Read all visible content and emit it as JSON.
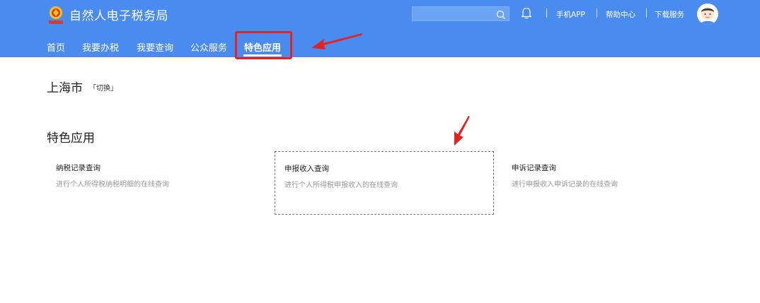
{
  "header": {
    "title": "自然人电子税务局",
    "search_placeholder": "",
    "links": [
      "手机APP",
      "帮助中心",
      "下载服务"
    ]
  },
  "nav": {
    "items": [
      "首页",
      "我要办税",
      "我要查询",
      "公众服务",
      "特色应用"
    ],
    "active_index": 4
  },
  "location": {
    "city": "上海市",
    "switch_label": "「切换」"
  },
  "section": {
    "title": "特色应用"
  },
  "cards": [
    {
      "title": "纳税记录查询",
      "desc": "进行个人所得税纳税明细的在线查询"
    },
    {
      "title": "申报收入查询",
      "desc": "进行个人所得税申报收入的在线查询"
    },
    {
      "title": "申诉记录查询",
      "desc": "进行申报收入申诉记录的在线查询"
    }
  ],
  "colors": {
    "header_bg": "#4a8bf0",
    "annotation": "#e52222"
  }
}
